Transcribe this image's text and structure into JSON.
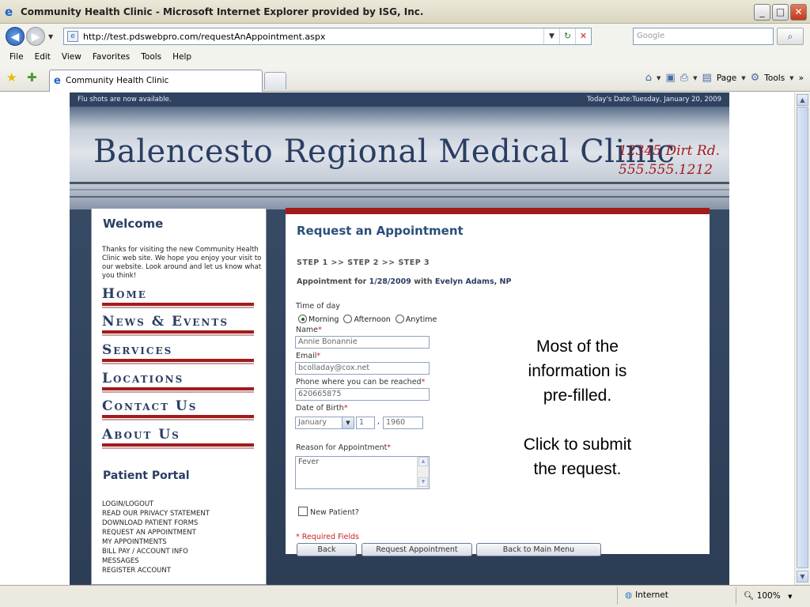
{
  "window": {
    "title": "Community Health Clinic - Microsoft Internet Explorer provided by ISG, Inc.",
    "minimize": "_",
    "maximize": "□",
    "close": "✕"
  },
  "address": {
    "url": "http://test.pdswebpro.com/requestAnAppointment.aspx",
    "search_placeholder": "Google"
  },
  "menu": {
    "file": "File",
    "edit": "Edit",
    "view": "View",
    "favorites": "Favorites",
    "tools": "Tools",
    "help": "Help"
  },
  "tab": {
    "label": "Community Health Clinic"
  },
  "commandbar": {
    "page": "Page",
    "tools": "Tools"
  },
  "site": {
    "announcement": "Flu shots are now available.",
    "date": "Today's Date:Tuesday, January 20, 2009",
    "clinic_name": "Balencesto Regional Medical Clinic",
    "address_line": "12345 Dirt Rd.",
    "phone_line": "555.555.1212"
  },
  "sidebar": {
    "welcome_title": "Welcome",
    "welcome_text": "Thanks for visiting the new Community Health Clinic web site. We hope you enjoy your visit to our website. Look around and let us know what you think!",
    "nav": [
      "Home",
      "News & Events",
      "Services",
      "Locations",
      "Contact Us",
      "About Us"
    ],
    "portal_title": "Patient Portal",
    "portal_links": [
      "LOGIN/LOGOUT",
      "READ OUR PRIVACY STATEMENT",
      "DOWNLOAD PATIENT FORMS",
      "REQUEST AN APPOINTMENT",
      "MY APPOINTMENTS",
      "BILL PAY / ACCOUNT INFO",
      "MESSAGES",
      "REGISTER ACCOUNT"
    ]
  },
  "form": {
    "title": "Request an Appointment",
    "steps": "STEP 1 >> STEP 2 >> STEP 3",
    "appt_prefix": "Appointment for",
    "appt_date": "1/28/2009",
    "appt_with": "with",
    "provider": "Evelyn Adams, NP",
    "time_of_day_label": "Time of day",
    "time_options": [
      "Morning",
      "Afternoon",
      "Anytime"
    ],
    "selected_time": "Morning",
    "name_label": "Name",
    "name_value": "Annie Bonannie",
    "email_label": "Email",
    "email_value": "bcolladay@cox.net",
    "phone_label": "Phone where you can be reached",
    "phone_value": "620665875",
    "dob_label": "Date of Birth",
    "dob_month": "January",
    "dob_day": "1",
    "dob_sep": ",",
    "dob_year": "1960",
    "reason_label": "Reason for Appointment",
    "reason_value": "Fever",
    "required_star": "*",
    "new_patient_label": "New Patient?",
    "required_note": "* Required Fields",
    "back_button": "Back",
    "submit_button": "Request Appointment",
    "main_menu_button": "Back to Main Menu"
  },
  "annotation": {
    "line1": "Most of the",
    "line2": "information is",
    "line3": "pre-filled.",
    "line4": "Click to submit",
    "line5": "the request."
  },
  "status": {
    "zone": "Internet",
    "zoom": "100%"
  }
}
